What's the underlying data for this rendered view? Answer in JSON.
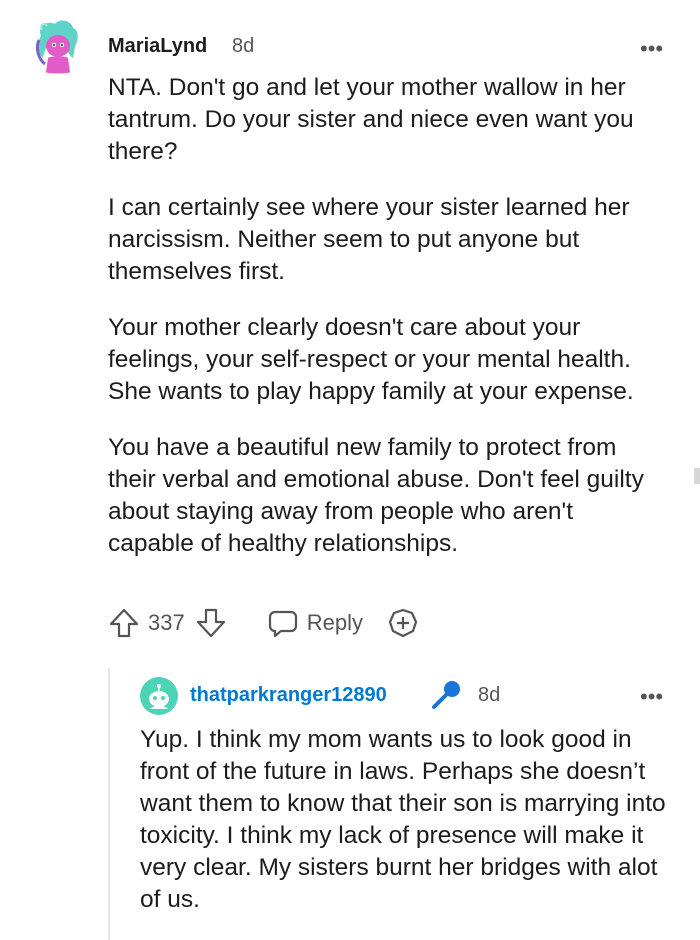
{
  "comment1": {
    "username": "MariaLynd",
    "age": "8d",
    "more": "•••",
    "paragraphs": [
      "NTA. Don't go and let your mother wallow in her tantrum. Do your sister and niece even want you there?",
      "I can certainly see where your sister learned her narcissism. Neither seem to put anyone but themselves first.",
      "Your mother clearly doesn't care about your feelings, your self-respect or your mental health. She wants to play happy family at your expense.",
      "You have a beautiful new family to protect from their verbal and emotional abuse. Don't feel guilty about staying away from people who aren't capable of healthy relationships."
    ],
    "votes": "337",
    "reply_label": "Reply"
  },
  "comment2": {
    "username": "thatparkranger12890",
    "username_color": "#0079d3",
    "age": "8d",
    "more": "•••",
    "text": "Yup. I think my mom wants us to look good in front of the future in laws. Perhaps she doesn’t want them to know that their son is marrying into toxicity. I think my lack of presence will make it very clear. My sisters burnt her bridges with alot of us."
  },
  "icons": {
    "avatar1": "snoo-avatar-teal-hair-pink",
    "avatar2": "snoo-avatar-teal",
    "upvote": "upvote-arrow-icon",
    "downvote": "downvote-arrow-icon",
    "reply": "speech-bubble-icon",
    "award": "award-plus-icon",
    "mic": "microphone-icon"
  }
}
